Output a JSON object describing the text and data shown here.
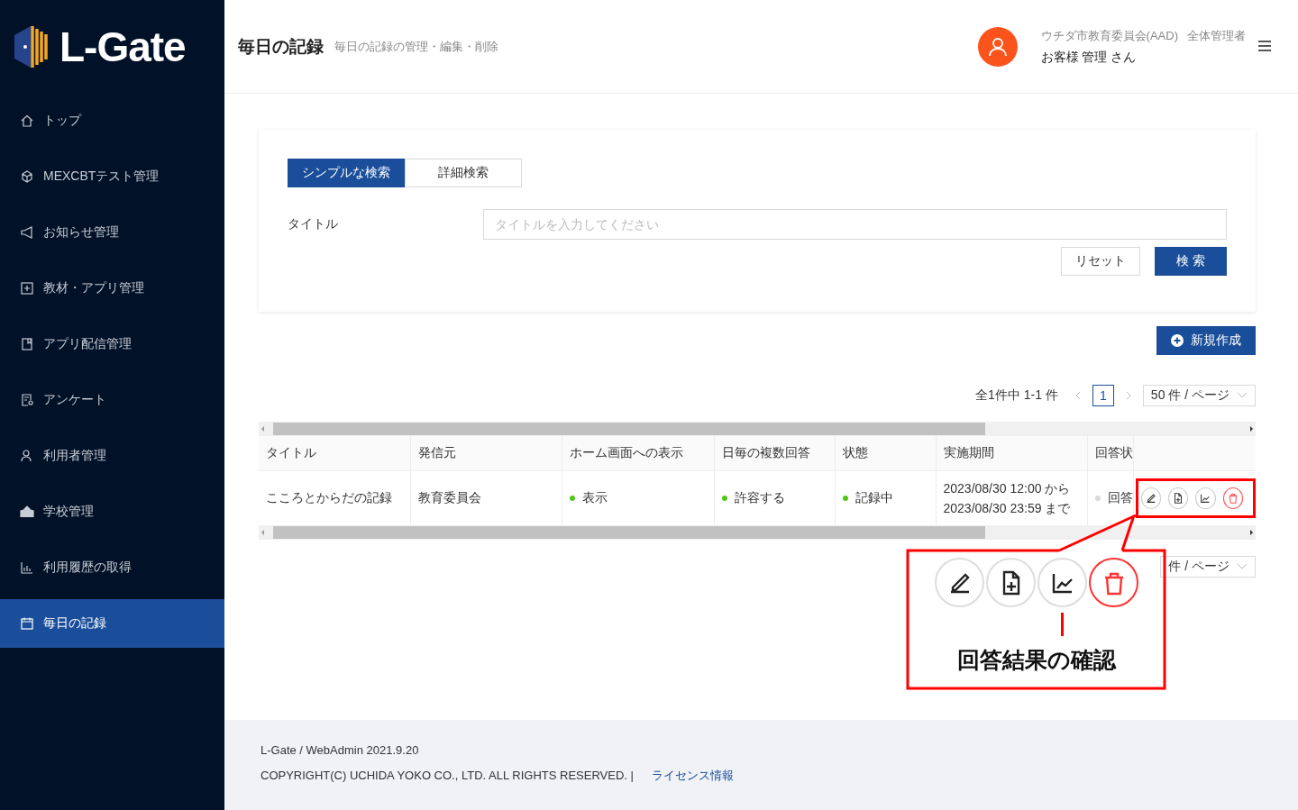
{
  "sidebar": {
    "logo": "L-Gate",
    "items": [
      {
        "label": "トップ",
        "selected": false
      },
      {
        "label": "MEXCBTテスト管理",
        "selected": false
      },
      {
        "label": "お知らせ管理",
        "selected": false
      },
      {
        "label": "教材・アプリ管理",
        "selected": false
      },
      {
        "label": "アプリ配信管理",
        "selected": false
      },
      {
        "label": "アンケート",
        "selected": false
      },
      {
        "label": "利用者管理",
        "selected": false
      },
      {
        "label": "学校管理",
        "selected": false
      },
      {
        "label": "利用履歴の取得",
        "selected": false
      },
      {
        "label": "毎日の記録",
        "selected": true
      }
    ]
  },
  "header": {
    "title": "毎日の記録",
    "subtitle": "毎日の記録の管理・編集・削除",
    "organization": "ウチダ市教育委員会(AAD)",
    "role": "全体管理者",
    "user_name": "お客様 管理 さん"
  },
  "search": {
    "tabs": [
      {
        "label": "シンプルな検索",
        "selected": true
      },
      {
        "label": "詳細検索",
        "selected": false
      }
    ],
    "field_label": "タイトル",
    "placeholder": "タイトルを入力してください",
    "reset_button": "リセット",
    "search_button": "検 索"
  },
  "new_button": "新規作成",
  "pagination": {
    "summary": "全1件中 1-1 件",
    "pages": [
      {
        "label": "1",
        "selected": true
      }
    ],
    "page_size": "50 件 / ページ"
  },
  "table": {
    "columns": [
      "タイトル",
      "発信元",
      "ホーム画面への表示",
      "日毎の複数回答",
      "状態",
      "実施期間",
      "回答状"
    ],
    "rows": [
      {
        "cells": [
          {
            "text": "こころとからだの記録"
          },
          {
            "text": "教育委員会"
          },
          {
            "text": "表示",
            "color": "#52c41a"
          },
          {
            "text": "許容する",
            "color": "#52c41a"
          },
          {
            "text": "記録中",
            "color": "#52c41a"
          },
          {
            "lines": [
              "2023/08/30 12:00 から",
              "2023/08/30 23:59 まで"
            ]
          },
          {
            "text": "回答",
            "color": "#d9d9d9"
          }
        ]
      }
    ]
  },
  "bottom_pagination": {
    "page_size": "件 / ページ"
  },
  "callout": {
    "label": "回答結果の確認"
  },
  "footer": {
    "version": "L-Gate / WebAdmin 2021.9.20",
    "copyright": "COPYRIGHT(C) UCHIDA YOKO CO., LTD. ALL RIGHTS RESERVED. |",
    "link": "ライセンス情報"
  }
}
